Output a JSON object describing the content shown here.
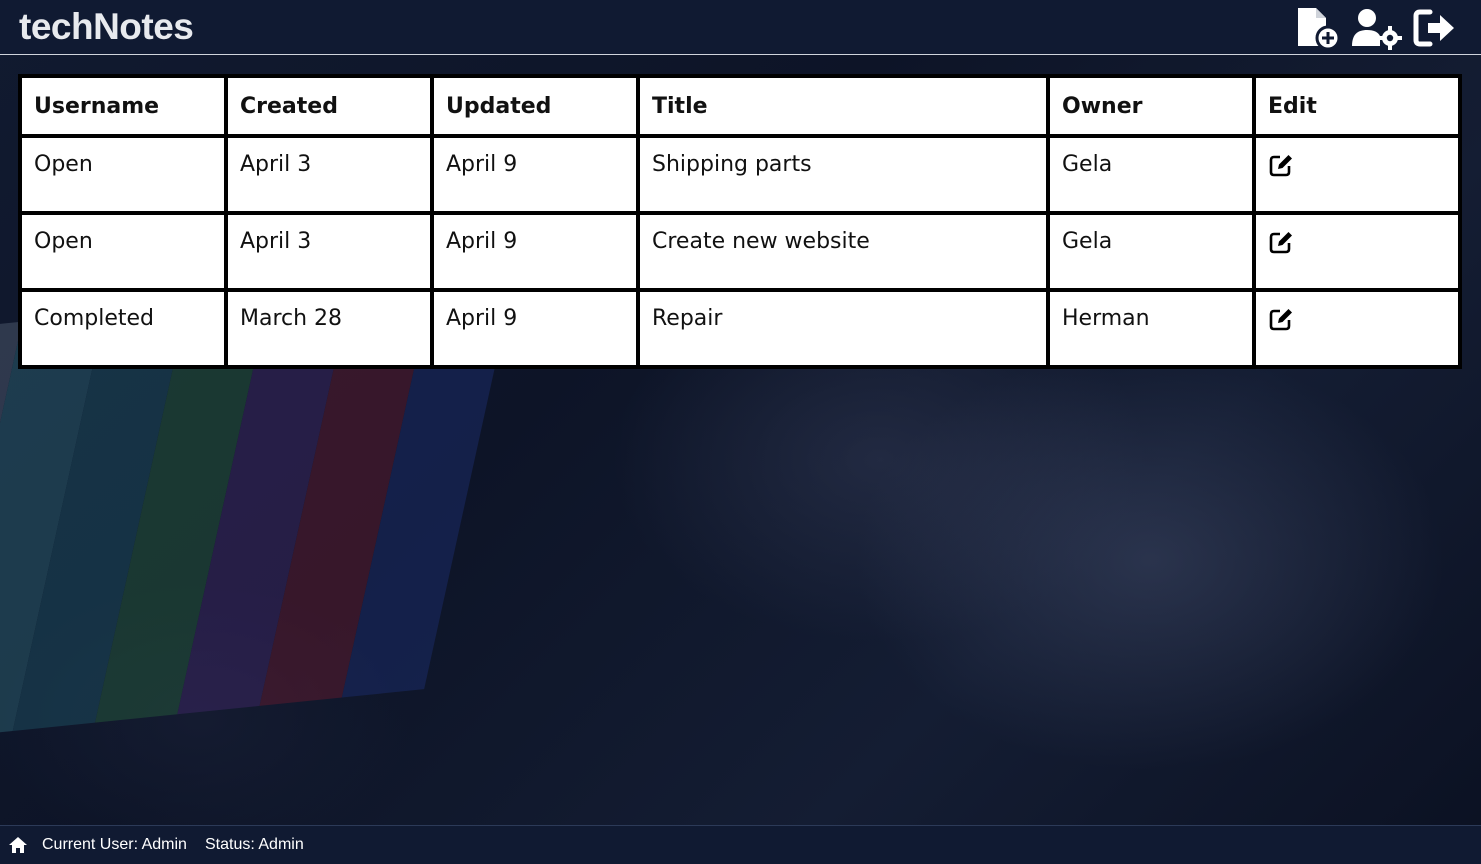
{
  "header": {
    "logo": "techNotes",
    "icons": [
      "file-plus-icon",
      "user-gear-icon",
      "logout-icon"
    ]
  },
  "table": {
    "columns": [
      "Username",
      "Created",
      "Updated",
      "Title",
      "Owner",
      "Edit"
    ],
    "rows": [
      {
        "status": "Open",
        "created": "April 3",
        "updated": "April 9",
        "title": "Shipping parts",
        "owner": "Gela",
        "edit_icon": "edit-icon"
      },
      {
        "status": "Open",
        "created": "April 3",
        "updated": "April 9",
        "title": "Create new website",
        "owner": "Gela",
        "edit_icon": "edit-icon"
      },
      {
        "status": "Completed",
        "created": "March 28",
        "updated": "April 9",
        "title": "Repair",
        "owner": "Herman",
        "edit_icon": "edit-icon"
      }
    ]
  },
  "footer": {
    "home_icon": "home-icon",
    "current_user": "Current User: Admin",
    "status": "Status: Admin"
  },
  "colors": {
    "header_bg": "#101a32",
    "status_open": "#a52626",
    "status_completed": "#37c73a"
  }
}
